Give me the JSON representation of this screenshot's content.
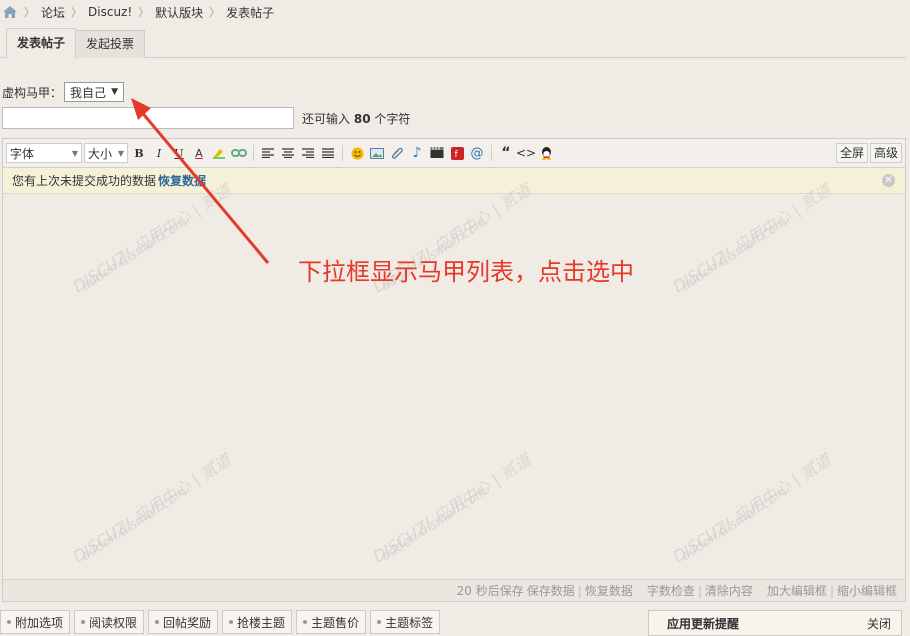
{
  "breadcrumb": {
    "home_icon": "home-icon",
    "items": [
      "论坛",
      "Discuz!",
      "默认版块",
      "发表帖子"
    ]
  },
  "tabs": {
    "post": "发表帖子",
    "poll": "发起投票"
  },
  "alias": {
    "label": "虚构马甲：",
    "selected": "我自己"
  },
  "title_field": {
    "value": "",
    "hint_prefix": "还可输入",
    "hint_count": "80",
    "hint_suffix": "个字符"
  },
  "toolbar": {
    "font_label": "字体",
    "size_label": "大小",
    "fullscreen": "全屏",
    "advanced": "高级"
  },
  "notice": {
    "text": "您有上次未提交成功的数据",
    "restore": "恢复数据"
  },
  "watermark": {
    "brand": "DISCUZ!",
    "center": "应用中心",
    "site": "addon.dismall.com",
    "author": "贰道"
  },
  "statusbar": {
    "autosave": "20 秒后保存",
    "save": "保存数据",
    "restore": "恢复数据",
    "check": "字数检查",
    "clear": "清除内容",
    "enlarge": "加大编辑框",
    "shrink": "缩小编辑框"
  },
  "annotation": "下拉框显示马甲列表，点击选中",
  "options": [
    "附加选项",
    "阅读权限",
    "回帖奖励",
    "抢楼主题",
    "主题售价",
    "主题标签"
  ],
  "update_panel": {
    "title": "应用更新提醒",
    "close": "关闭"
  },
  "colors": {
    "annotation": "#e5392a",
    "restore_link": "#336699",
    "background": "#f1ebe5"
  }
}
